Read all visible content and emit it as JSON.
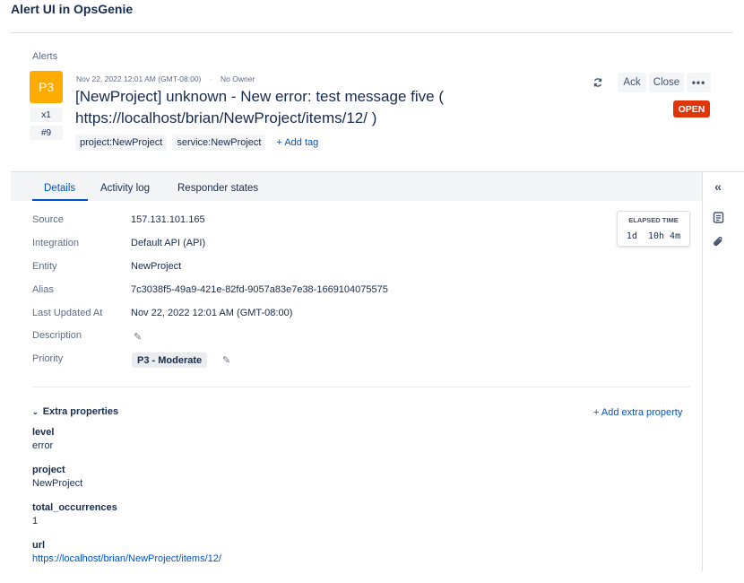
{
  "page": {
    "heading": "Alert UI in OpsGenie"
  },
  "breadcrumb": "Alerts",
  "alert": {
    "priority": "P3",
    "count_badge": "x1",
    "tiny_id": "#9",
    "created": "Nov 22, 2022 12:01 AM (GMT-08:00)",
    "separator": "·",
    "owner": "No Owner",
    "title": "[NewProject] unknown - New error: test message five ( https://localhost/brian/NewProject/items/12/ )",
    "tags": [
      "project:NewProject",
      "service:NewProject"
    ],
    "add_tag_label": "+ Add tag",
    "status": "OPEN"
  },
  "actions": {
    "refresh_icon": "refresh-icon",
    "ack_label": "Ack",
    "close_label": "Close",
    "more_label": "•••"
  },
  "tabs": [
    {
      "label": "Details",
      "active": true
    },
    {
      "label": "Activity log",
      "active": false
    },
    {
      "label": "Responder states",
      "active": false
    }
  ],
  "details": {
    "source": {
      "label": "Source",
      "value": "157.131.101.165"
    },
    "integration": {
      "label": "Integration",
      "value": "Default API (API)"
    },
    "entity": {
      "label": "Entity",
      "value": "NewProject"
    },
    "alias": {
      "label": "Alias",
      "value": "7c3038f5-49a9-421e-82fd-9057a83e7e38-1669104075575"
    },
    "last_updated": {
      "label": "Last Updated At",
      "value": "Nov 22, 2022 12:01 AM (GMT-08:00)"
    },
    "description": {
      "label": "Description",
      "value": ""
    },
    "priority": {
      "label": "Priority",
      "value": "P3 - Moderate"
    }
  },
  "elapsed": {
    "label": "ELAPSED TIME",
    "value": "1d  10h 4m"
  },
  "extra": {
    "heading": "Extra properties",
    "add_label": "+ Add extra property",
    "props": [
      {
        "key": "level",
        "value": "error"
      },
      {
        "key": "project",
        "value": "NewProject"
      },
      {
        "key": "total_occurrences",
        "value": "1"
      },
      {
        "key": "url",
        "value": "https://localhost/brian/NewProject/items/12/"
      }
    ]
  },
  "colors": {
    "priority_p3": "#ffab00",
    "status_open": "#de350b",
    "link": "#0052cc"
  }
}
